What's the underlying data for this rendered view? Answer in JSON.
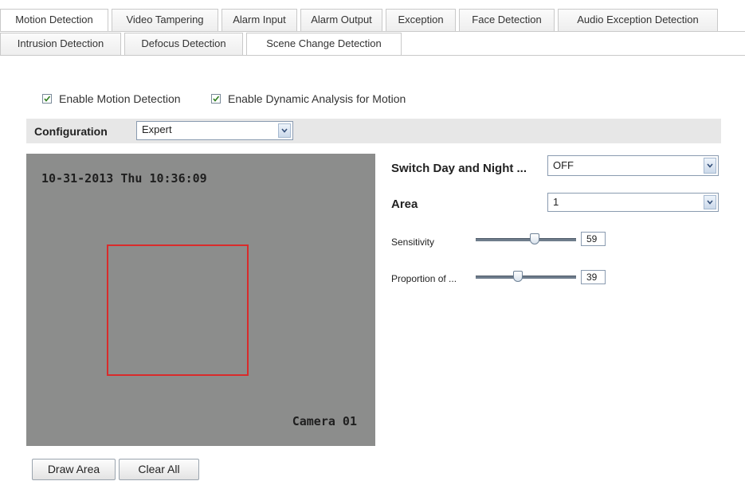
{
  "tabs_row1": [
    {
      "label": "Motion Detection",
      "active": true
    },
    {
      "label": "Video Tampering",
      "active": false
    },
    {
      "label": "Alarm Input",
      "active": false
    },
    {
      "label": "Alarm Output",
      "active": false
    },
    {
      "label": "Exception",
      "active": false
    },
    {
      "label": "Face Detection",
      "active": false
    },
    {
      "label": "Audio Exception Detection",
      "active": false
    }
  ],
  "tabs_row2": [
    {
      "label": "Intrusion Detection",
      "active": false
    },
    {
      "label": "Defocus Detection",
      "active": false
    },
    {
      "label": "Scene Change Detection",
      "active": false
    }
  ],
  "options": {
    "enable_motion": {
      "label": "Enable Motion Detection",
      "checked": true
    },
    "enable_dynamic": {
      "label": "Enable Dynamic Analysis for Motion",
      "checked": true
    }
  },
  "configuration": {
    "label": "Configuration",
    "value": "Expert"
  },
  "video": {
    "timestamp": "10-31-2013 Thu 10:36:09",
    "camera": "Camera 01"
  },
  "settings": {
    "switch_day_night": {
      "label": "Switch Day and Night ...",
      "value": "OFF"
    },
    "area": {
      "label": "Area",
      "value": "1"
    },
    "sensitivity": {
      "label": "Sensitivity",
      "value": "59"
    },
    "proportion": {
      "label": "Proportion of ...",
      "value": "39"
    }
  },
  "buttons": {
    "draw_area": "Draw Area",
    "clear_all": "Clear All"
  }
}
